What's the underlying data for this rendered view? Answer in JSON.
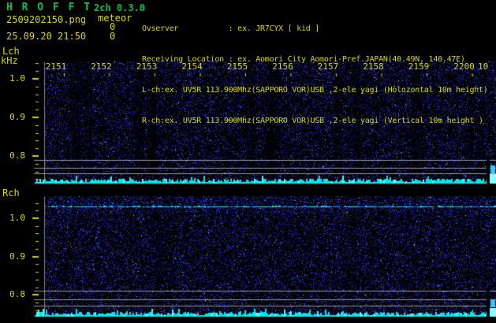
{
  "header": {
    "title": "H R O F F T",
    "version": "2ch 0.3.0",
    "filename": "2509202150.png",
    "mode": "meteor",
    "count_l": "0",
    "count_r": "0",
    "datetime": "25.09.20 21:50",
    "info_lines": [
      "Ovserver           : ex. JR7CYX [ kid ]",
      "Receiving Location : ex. Aomori City Aomori-Pref.JAPAN(40.49N, 140.47E)",
      "L-ch:ex. UV5R 113.900Mhz(SAPPORO VOR)USB ,2-ele yagi (Holozontal 10m height)",
      "R-ch:ex. UV5R 113.900Mhz(SAPPORO VOR)USB ,2-ele yagi (Vertical 10m height )"
    ]
  },
  "lch_panel": {
    "label": "Lch",
    "unit": "kHz",
    "freq_ticks": [
      "1.0",
      "0.9",
      "0.8"
    ]
  },
  "rch_panel": {
    "label": "Rch",
    "freq_ticks": [
      "1.0",
      "0.9",
      "0.8"
    ]
  },
  "time_axis": {
    "labels": [
      "2151",
      "2152",
      "2153",
      "2154",
      "2155",
      "2156",
      "2157",
      "2158",
      "2159",
      "2200"
    ],
    "partial_label": "10"
  },
  "colors": {
    "green": "#00c44c",
    "yellow": "#d8d800",
    "cyan": "#00e8e8",
    "bright_cyan": "#8cffff",
    "gray_line": "#9a9a9a",
    "background": "#000000",
    "noise_palette": [
      "#000026",
      "#0a0a46",
      "#12126a",
      "#1a1a90",
      "#2230c0",
      "#2a44e8",
      "#3656ff"
    ],
    "noise_spark_cyan": "#39d7ff",
    "noise_spark_white": "#d8e8ff",
    "carrier_segments": [
      "#00e0ff",
      "#00ff99",
      "#2060ff",
      "#18c8ff"
    ]
  }
}
